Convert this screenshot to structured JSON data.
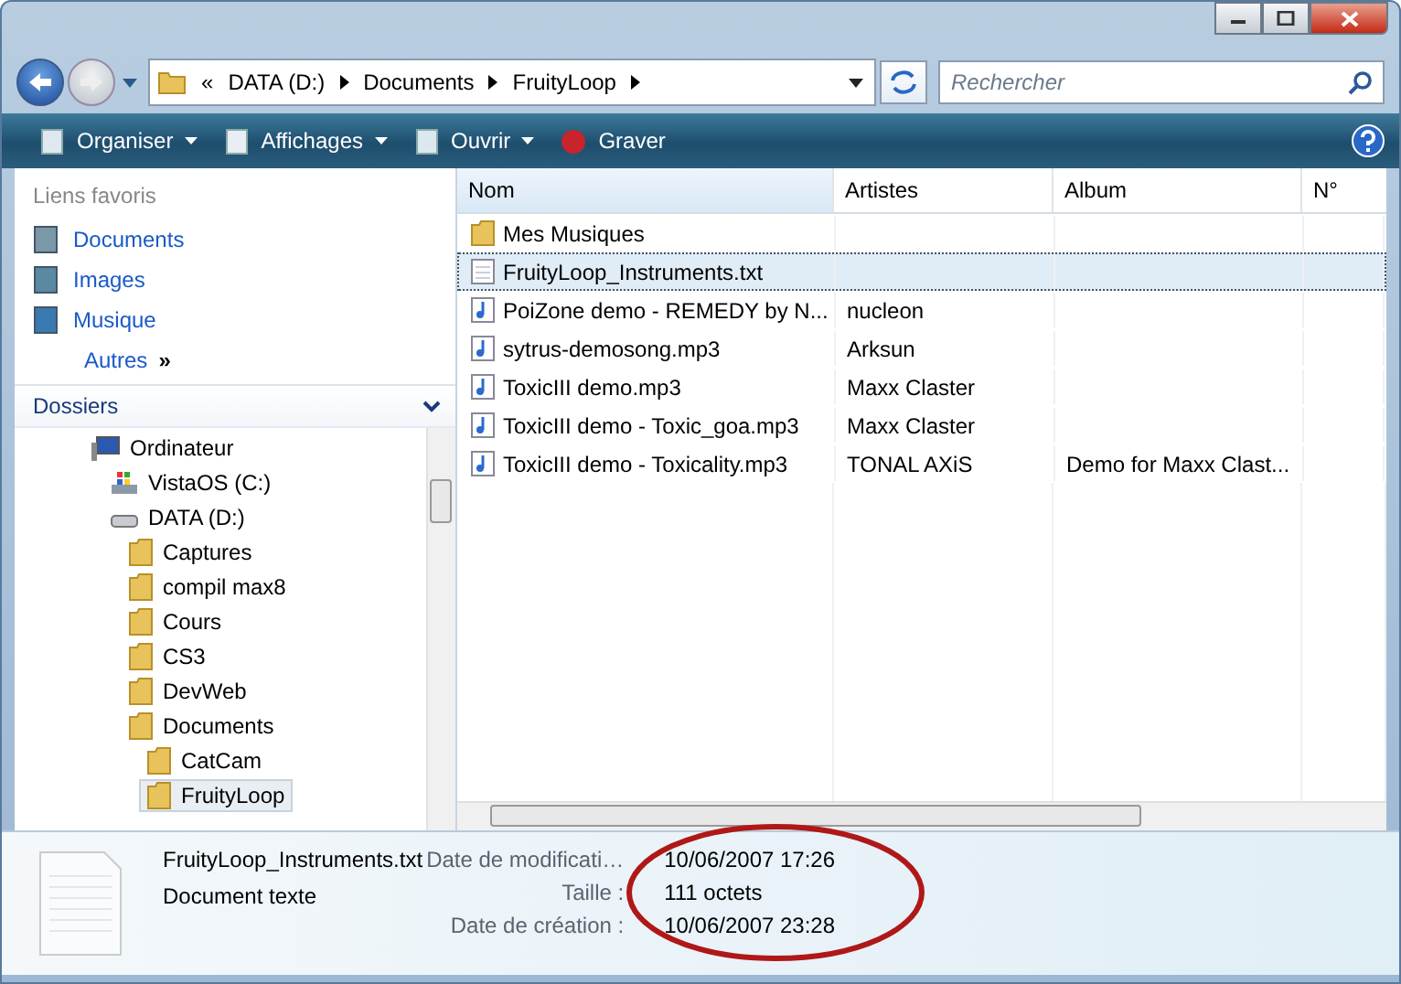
{
  "address": {
    "overflow": "«",
    "crumbs": [
      "DATA (D:)",
      "Documents",
      "FruityLoop"
    ]
  },
  "search": {
    "placeholder": "Rechercher"
  },
  "toolbar": [
    {
      "label": "Organiser",
      "kind": "organize"
    },
    {
      "label": "Affichages",
      "kind": "views"
    },
    {
      "label": "Ouvrir",
      "kind": "open"
    },
    {
      "label": "Graver",
      "kind": "burn"
    }
  ],
  "favorites": {
    "title": "Liens favoris",
    "items": [
      {
        "label": "Documents",
        "kind": "documents"
      },
      {
        "label": "Images",
        "kind": "images"
      },
      {
        "label": "Musique",
        "kind": "music"
      }
    ],
    "more": "Autres",
    "more_icon": "»"
  },
  "folders": {
    "title": "Dossiers",
    "tree": [
      {
        "label": "Ordinateur",
        "kind": "computer",
        "selected": false,
        "children": [
          {
            "label": "VistaOS (C:)",
            "kind": "osdrive",
            "selected": false
          },
          {
            "label": "DATA (D:)",
            "kind": "drive",
            "selected": false,
            "children": [
              {
                "label": "Captures",
                "kind": "folder",
                "selected": false
              },
              {
                "label": "compil max8",
                "kind": "folder",
                "selected": false
              },
              {
                "label": "Cours",
                "kind": "folder",
                "selected": false
              },
              {
                "label": "CS3",
                "kind": "folder",
                "selected": false
              },
              {
                "label": "DevWeb",
                "kind": "folder",
                "selected": false
              },
              {
                "label": "Documents",
                "kind": "folder",
                "selected": false,
                "children": [
                  {
                    "label": "CatCam",
                    "kind": "folder",
                    "selected": false
                  },
                  {
                    "label": "FruityLoop",
                    "kind": "folder",
                    "selected": true
                  }
                ]
              }
            ]
          }
        ]
      }
    ]
  },
  "table": {
    "columns": [
      "Nom",
      "Artistes",
      "Album",
      "N°"
    ],
    "rows": [
      {
        "kind": "folder",
        "selected": false,
        "cells": [
          "Mes Musiques",
          "",
          ""
        ]
      },
      {
        "kind": "text",
        "selected": true,
        "cells": [
          "FruityLoop_Instruments.txt",
          "",
          ""
        ]
      },
      {
        "kind": "audio",
        "selected": false,
        "cells": [
          "PoiZone demo - REMEDY by N...",
          "nucleon",
          ""
        ]
      },
      {
        "kind": "audio",
        "selected": false,
        "cells": [
          "sytrus-demosong.mp3",
          "Arksun",
          ""
        ]
      },
      {
        "kind": "audio",
        "selected": false,
        "cells": [
          "ToxicIII demo.mp3",
          "Maxx Claster",
          ""
        ]
      },
      {
        "kind": "audio",
        "selected": false,
        "cells": [
          "ToxicIII demo - Toxic_goa.mp3",
          "Maxx Claster",
          ""
        ]
      },
      {
        "kind": "audio",
        "selected": false,
        "cells": [
          "ToxicIII demo - Toxicality.mp3",
          "TONAL AXiS",
          "Demo for Maxx Clast..."
        ]
      }
    ]
  },
  "details": {
    "name": "FruityLoop_Instruments.txt",
    "type": "Document texte",
    "properties": [
      {
        "label": "Date de modificati…",
        "value": "10/06/2007 17:26"
      },
      {
        "label": "Taille :",
        "value": "111 octets"
      },
      {
        "label": "Date de création :",
        "value": "10/06/2007 23:28"
      }
    ]
  }
}
